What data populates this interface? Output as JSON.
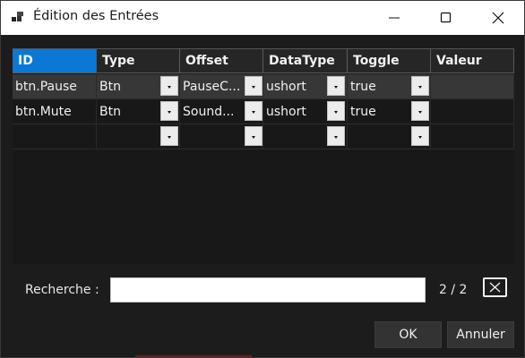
{
  "window": {
    "title": "Édition des Entrées",
    "app_icon": "windows-grid-icon",
    "controls": [
      "minimize-icon",
      "maximize-icon",
      "close-icon"
    ]
  },
  "grid": {
    "columns": [
      "ID",
      "Type",
      "Offset",
      "DataType",
      "Toggle",
      "Valeur"
    ],
    "active_column": "ID",
    "rows": [
      {
        "id": "btn.Pause",
        "type": "Btn",
        "offset": "PauseC...",
        "datatype": "ushort",
        "toggle": "true",
        "valeur": "",
        "selected": true
      },
      {
        "id": "btn.Mute",
        "type": "Btn",
        "offset": "Sound...",
        "datatype": "ushort",
        "toggle": "true",
        "valeur": "",
        "selected": false
      },
      {
        "id": "",
        "type": "",
        "offset": "",
        "datatype": "",
        "toggle": "",
        "valeur": "",
        "selected": false
      }
    ]
  },
  "search": {
    "label": "Recherche :",
    "value": "",
    "placeholder": "",
    "counter": "2 / 2",
    "clear_icon": "clear-search-icon"
  },
  "buttons": {
    "ok": "OK",
    "cancel": "Annuler"
  },
  "colors": {
    "accent": "#0a78d4",
    "background": "#1c1c1c",
    "selected_row": "#373737"
  }
}
